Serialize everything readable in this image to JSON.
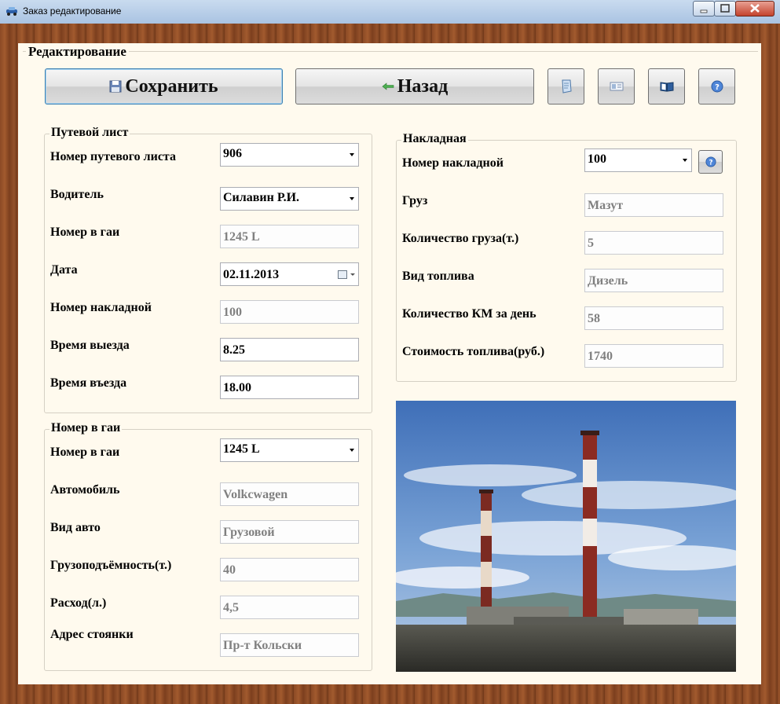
{
  "window": {
    "title": "Заказ редактирование"
  },
  "section_title": "Редактирование",
  "toolbar": {
    "save_label": "Сохранить",
    "back_label": "Назад"
  },
  "waybill": {
    "legend": "Путевой лист",
    "number_label": "Номер путевого листа",
    "number_value": "906",
    "driver_label": "Водитель",
    "driver_value": "Силавин Р.И.",
    "gai_label": "Номер в гаи",
    "gai_value": "1245 L",
    "date_label": "Дата",
    "date_value": "02.11.2013",
    "invoice_label": "Номер накладной",
    "invoice_value": "100",
    "depart_label": "Время выезда",
    "depart_value": "8.25",
    "arrive_label": "Время въезда",
    "arrive_value": "18.00"
  },
  "vehicle": {
    "legend": "Номер в гаи",
    "gai_label": "Номер в гаи",
    "gai_value": "1245 L",
    "car_label": "Автомобиль",
    "car_value": "Volkcwagen",
    "type_label": "Вид авто",
    "type_value": "Грузовой",
    "capacity_label": "Грузоподъёмность(т.)",
    "capacity_value": "40",
    "consumption_label": "Расход(л.)",
    "consumption_value": "4,5",
    "parking_label": "Адрес стоянки",
    "parking_value": "Пр-т Кольски"
  },
  "invoice": {
    "legend": "Накладная",
    "number_label": "Номер накладной",
    "number_value": "100",
    "cargo_label": "Груз",
    "cargo_value": "Мазут",
    "cargo_qty_label": "Количество груза(т.)",
    "cargo_qty_value": "5",
    "fuel_label": "Вид топлива",
    "fuel_value": "Дизель",
    "km_label": "Количество КМ за день",
    "km_value": "58",
    "cost_label": "Стоимость топлива(руб.)",
    "cost_value": "1740"
  },
  "icons": [
    "car-icon",
    "floppy-icon",
    "arrow-left-icon",
    "document-icon",
    "id-card-icon",
    "book-icon",
    "help-icon",
    "calendar-icon"
  ],
  "colors": {
    "accent": "#3c7fb1",
    "panel_bg": "#fffaee",
    "wood": "#8b4a25"
  }
}
